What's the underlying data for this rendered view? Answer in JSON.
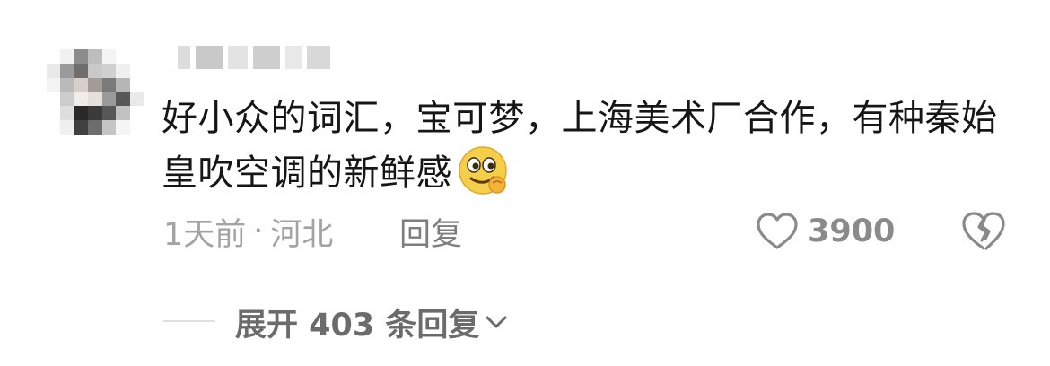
{
  "comment": {
    "text": "好小众的词汇，宝可梦，上海美术厂合作，有种秦始皇吹空调的新鲜感",
    "emoji": "smirk-emoji",
    "time": "1天前",
    "separator": "·",
    "location": "河北",
    "reply_label": "回复",
    "like_count": "3900"
  },
  "replies": {
    "expand_label": "展开 403 条回复"
  },
  "colors": {
    "text": "#161616",
    "meta": "#a3a3a3",
    "action": "#7e7e7e",
    "icon": "#8a8a8a",
    "emoji_face": "#f6cf4a"
  }
}
